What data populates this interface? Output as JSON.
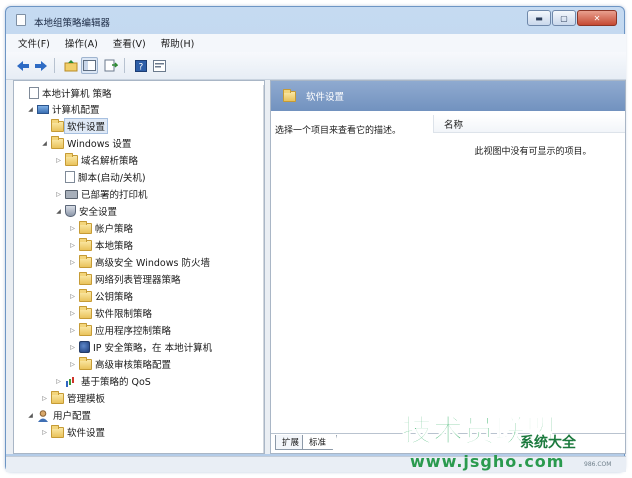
{
  "window": {
    "title": "本地组策略编辑器",
    "buttons": {
      "minimize": "▬",
      "maximize": "▢",
      "close": "✕"
    }
  },
  "menu": [
    "文件(F)",
    "操作(A)",
    "查看(V)",
    "帮助(H)"
  ],
  "toolbar": {
    "icons": [
      "back-arrow-icon",
      "forward-arrow-icon",
      "up-folder-icon",
      "show-tree-icon",
      "export-list-icon",
      "help-icon",
      "properties-icon"
    ],
    "colors": {
      "back": "#2e6bc4",
      "forward": "#2e6bc4",
      "help": "#2f5fa8"
    }
  },
  "tree": [
    {
      "label": "本地计算机 策略",
      "icon": "policy-doc-icon",
      "arrow": ""
    },
    {
      "label": "计算机配置",
      "icon": "computer-icon",
      "arrow": "◢"
    },
    {
      "label": "软件设置",
      "icon": "folder-icon",
      "arrow": "",
      "selected": true
    },
    {
      "label": "Windows 设置",
      "icon": "folder-icon",
      "arrow": "◢"
    },
    {
      "label": "域名解析策略",
      "icon": "folder-icon",
      "arrow": "▷"
    },
    {
      "label": "脚本(启动/关机)",
      "icon": "script-doc-icon",
      "arrow": ""
    },
    {
      "label": "已部署的打印机",
      "icon": "printer-icon",
      "arrow": "▷"
    },
    {
      "label": "安全设置",
      "icon": "security-shield-icon",
      "arrow": "◢"
    },
    {
      "label": "帐户策略",
      "icon": "folder-icon",
      "arrow": "▷"
    },
    {
      "label": "本地策略",
      "icon": "folder-icon",
      "arrow": "▷"
    },
    {
      "label": "高级安全 Windows 防火墙",
      "icon": "folder-icon",
      "arrow": "▷"
    },
    {
      "label": "网络列表管理器策略",
      "icon": "folder-icon",
      "arrow": ""
    },
    {
      "label": "公钥策略",
      "icon": "folder-icon",
      "arrow": "▷"
    },
    {
      "label": "软件限制策略",
      "icon": "folder-icon",
      "arrow": "▷"
    },
    {
      "label": "应用程序控制策略",
      "icon": "folder-icon",
      "arrow": "▷"
    },
    {
      "label": "IP 安全策略，在 本地计算机",
      "icon": "ip-security-icon",
      "arrow": "▷"
    },
    {
      "label": "高级审核策略配置",
      "icon": "folder-icon",
      "arrow": "▷"
    },
    {
      "label": "基于策略的 QoS",
      "icon": "qos-chart-icon",
      "arrow": "▷"
    },
    {
      "label": "管理模板",
      "icon": "folder-icon",
      "arrow": "▷"
    },
    {
      "label": "用户配置",
      "icon": "user-icon",
      "arrow": "◢"
    },
    {
      "label": "软件设置",
      "icon": "folder-icon",
      "arrow": "▷"
    }
  ],
  "right_pane": {
    "title": "软件设置",
    "description": "选择一个项目来查看它的描述。",
    "column_header": "名称",
    "empty_message": "此视图中没有可显示的项目。"
  },
  "tabs": [
    "扩展",
    "标准"
  ],
  "watermark": {
    "main": "技术员联盟",
    "sub": "系统大全",
    "url": "www.jsgho.com",
    "url_small": "986.COM"
  }
}
